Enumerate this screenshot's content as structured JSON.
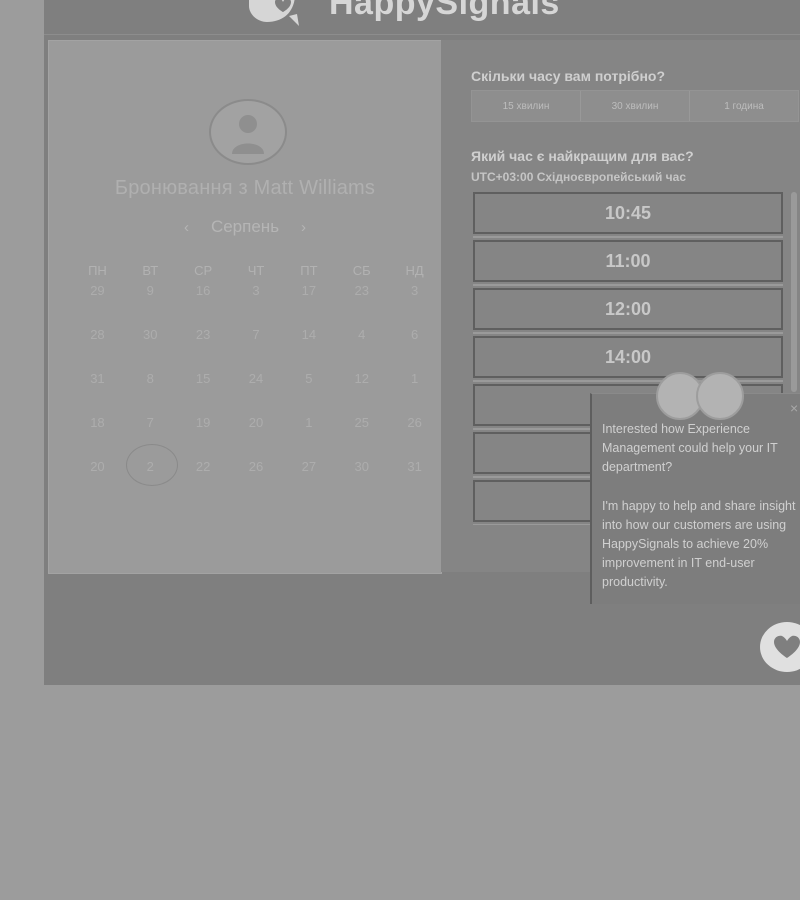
{
  "brand": {
    "name": "HappySignals"
  },
  "calendar": {
    "title": "Бронювання з Matt Williams",
    "month": "Серпень",
    "prev_arrow": "‹",
    "next_arrow": "›",
    "weekdays": [
      "ПН",
      "ВТ",
      "СР",
      "ЧТ",
      "ПТ",
      "СБ",
      "НД"
    ],
    "weeks": [
      [
        "29",
        "9",
        "16",
        "3",
        "17",
        "23",
        "3"
      ],
      [
        "28",
        "30",
        "23",
        "7",
        "14",
        "4",
        "6"
      ],
      [
        "31",
        "8",
        "15",
        "24",
        "5",
        "12",
        "1"
      ],
      [
        "18",
        "7",
        "19",
        "20",
        "1",
        "25",
        "26"
      ],
      [
        "20",
        "2",
        "22",
        "26",
        "27",
        "30",
        "31"
      ]
    ]
  },
  "booking": {
    "duration_question": "Скільки часу вам потрібно?",
    "durations": [
      "15 хвилин",
      "30 хвилин",
      "1 година"
    ],
    "time_question": "Який час є найкращим для вас?",
    "timezone": "UTC+03:00 Східноєвропейський час",
    "slots": [
      "10:45",
      "11:00",
      "12:00",
      "14:00",
      "",
      "",
      ""
    ]
  },
  "chat": {
    "message_1": "Interested how Experience Management could help your IT department?",
    "message_2": "I'm happy to help and share insight into how our customers are using HappySignals to achieve 20% improvement in IT end-user productivity.",
    "close": "×"
  }
}
